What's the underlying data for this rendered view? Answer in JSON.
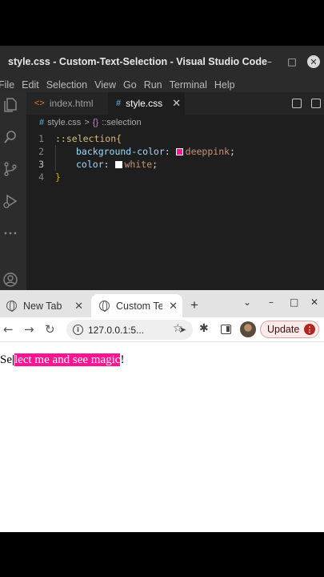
{
  "vscode": {
    "window_title": "style.css - Custom-Text-Selection - Visual Studio Code",
    "window_controls": {
      "minimize": "–",
      "maximize": "□",
      "close": "✕"
    },
    "menu": [
      "File",
      "Edit",
      "Selection",
      "View",
      "Go",
      "Run",
      "Terminal",
      "Help"
    ],
    "activity_icons": [
      "explorer-icon",
      "search-icon",
      "source-control-icon",
      "run-debug-icon",
      "more-icon",
      "account-icon"
    ],
    "tabs": [
      {
        "label": "index.html",
        "icon": "<>",
        "active": false
      },
      {
        "label": "style.css",
        "icon": "#",
        "active": true,
        "close": "✕"
      }
    ],
    "breadcrumb": {
      "file": "style.css",
      "separator": ">",
      "symbol": "::selection",
      "file_icon": "#",
      "symbol_icon": "{}"
    },
    "code_lines": [
      {
        "num": "1",
        "text": "::selection{"
      },
      {
        "num": "2",
        "prop": "background-color",
        "value": "deeppink",
        "swatch": "#ff1493"
      },
      {
        "num": "3",
        "prop": "color",
        "value": "white",
        "swatch": "#ffffff"
      },
      {
        "num": "4",
        "text": "}"
      }
    ],
    "colon": ":",
    "semicolon": ";"
  },
  "chrome": {
    "tabs": [
      {
        "label": "New Tab",
        "active": false,
        "close": "✕"
      },
      {
        "label": "Custom Text Selection",
        "active": true,
        "close": "✕"
      }
    ],
    "new_tab_symbol": "+",
    "window_controls": {
      "chevron": "⌄",
      "minimize": "–",
      "maximize": "□",
      "close": "✕"
    },
    "nav": {
      "back": "←",
      "forward": "→",
      "reload": "↻"
    },
    "address": {
      "url": "127.0.0.1:5...",
      "info_symbol": "i",
      "send_symbol": "➤"
    },
    "star_symbol": "☆",
    "extensions_symbol": "✱",
    "update_label": "Update",
    "update_menu_symbol": "⋮"
  },
  "page": {
    "prefix": "Se",
    "selected": "lect me and see magic",
    "suffix": "!"
  },
  "colors": {
    "accent_selection": "#ff1493",
    "vscode_bg": "#1e1e1e"
  }
}
